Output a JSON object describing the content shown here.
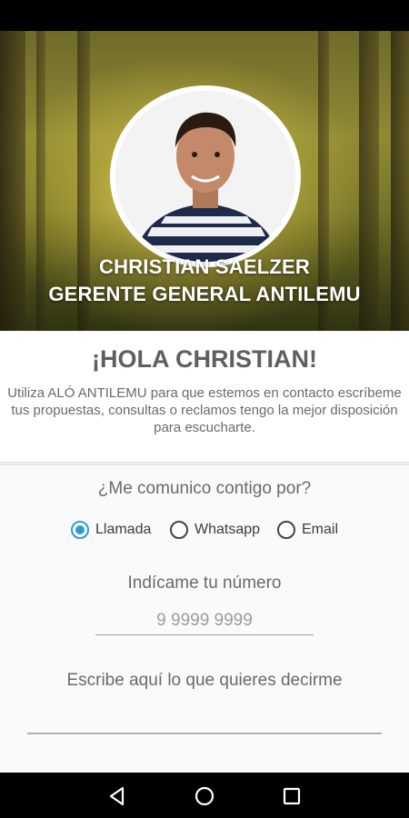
{
  "profile": {
    "name": "CHRISTIAN SAELZER",
    "role": "GERENTE GENERAL ANTILEMU"
  },
  "greeting": {
    "title": "¡HOLA CHRISTIAN!",
    "message": "Utiliza ALÓ ANTILEMU para que estemos en contacto escríbeme tus propuestas, consultas o reclamos tengo la mejor disposición para escucharte."
  },
  "contact": {
    "question": "¿Me comunico contigo por?",
    "options": [
      {
        "label": "Llamada",
        "selected": true
      },
      {
        "label": "Whatsapp",
        "selected": false
      },
      {
        "label": "Email",
        "selected": false
      }
    ],
    "accent_color": "#2d9ad6"
  },
  "phone": {
    "label": "Indícame tu número",
    "placeholder": "9 9999 9999",
    "value": ""
  },
  "message": {
    "label": "Escribe aquí lo que quieres decirme",
    "value": ""
  },
  "navigation": {
    "back_icon": "triangle-back-icon",
    "home_icon": "circle-home-icon",
    "recents_icon": "square-recents-icon"
  }
}
